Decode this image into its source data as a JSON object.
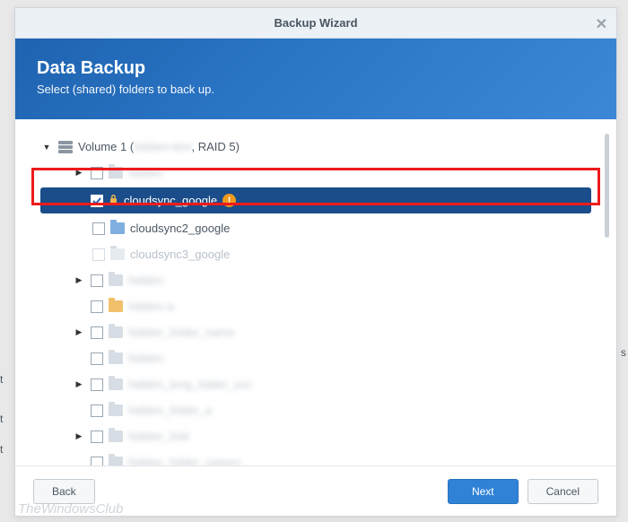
{
  "window": {
    "title": "Backup Wizard"
  },
  "header": {
    "title": "Data Backup",
    "subtitle": "Select (shared) folders to back up."
  },
  "tree": {
    "volume_label_prefix": "Volume 1 (",
    "volume_label_suffix": ", RAID 5)",
    "items": [
      {
        "label": "cloudsync_google"
      },
      {
        "label": "cloudsync2_google"
      },
      {
        "label": "cloudsync3_google"
      }
    ]
  },
  "footer": {
    "back": "Back",
    "next": "Next",
    "cancel": "Cancel"
  },
  "watermark": "TheWindowsClub",
  "bg": {
    "s1": "s",
    "t1": "t",
    "t2": "t",
    "t3": "t"
  }
}
